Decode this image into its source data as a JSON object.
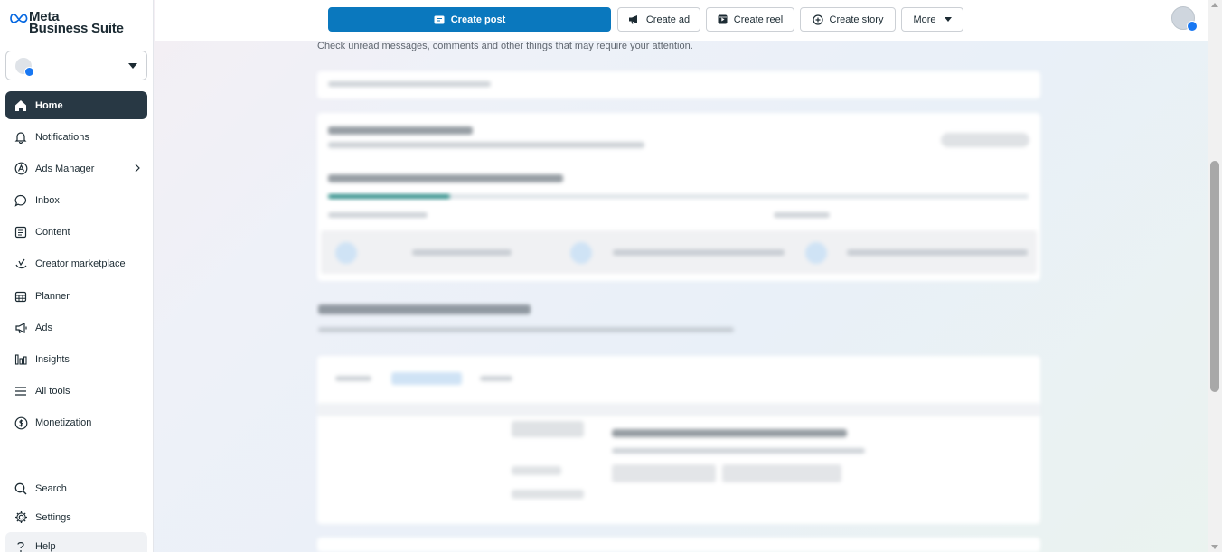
{
  "brand": {
    "line1": "Meta",
    "line2": "Business Suite"
  },
  "sidebar": {
    "items": [
      {
        "label": "Home",
        "icon": "home-icon"
      },
      {
        "label": "Notifications",
        "icon": "bell-icon"
      },
      {
        "label": "Ads Manager",
        "icon": "ads-manager-icon"
      },
      {
        "label": "Inbox",
        "icon": "chat-bubble-icon"
      },
      {
        "label": "Content",
        "icon": "content-icon"
      },
      {
        "label": "Creator marketplace",
        "icon": "creator-icon"
      },
      {
        "label": "Planner",
        "icon": "calendar-icon"
      },
      {
        "label": "Ads",
        "icon": "megaphone-icon"
      },
      {
        "label": "Insights",
        "icon": "bar-chart-icon"
      },
      {
        "label": "All tools",
        "icon": "menu-icon"
      },
      {
        "label": "Monetization",
        "icon": "dollar-icon"
      }
    ],
    "bottom": [
      {
        "label": "Search",
        "icon": "search-icon"
      },
      {
        "label": "Settings",
        "icon": "gear-icon"
      },
      {
        "label": "Help",
        "icon": "help-icon"
      }
    ]
  },
  "topbar": {
    "create_post": "Create post",
    "create_ad": "Create ad",
    "create_reel": "Create reel",
    "create_story": "Create story",
    "more": "More"
  },
  "main": {
    "subtitle": "Check unread messages, comments and other things that may require your attention."
  },
  "colors": {
    "primary": "#0a78be",
    "active_nav": "#283844",
    "facebook_blue": "#1877f2"
  }
}
